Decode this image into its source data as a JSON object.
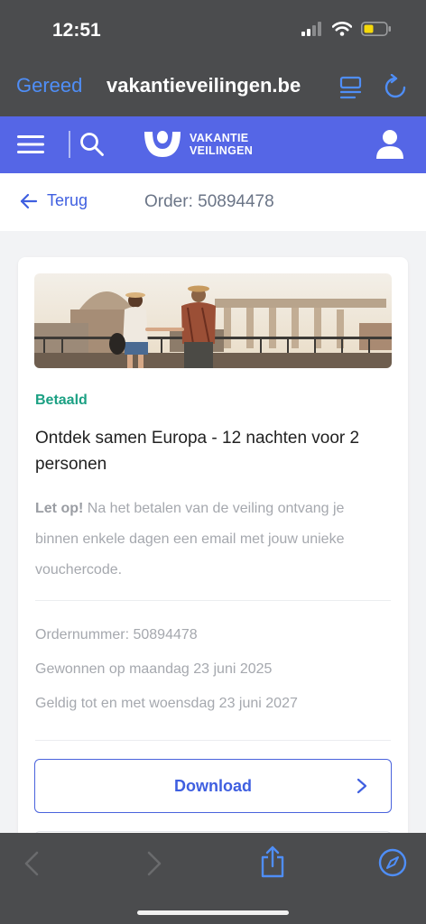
{
  "status_bar": {
    "time": "12:51"
  },
  "browser": {
    "done_label": "Gereed",
    "url": "vakantieveilingen.be"
  },
  "site": {
    "logo_line1": "VAKANTIE",
    "logo_line2": "VEILINGEN",
    "brand_color": "#5566e6"
  },
  "subnav": {
    "back_label": "Terug",
    "order_title": "Order: 50894478"
  },
  "order": {
    "status": "Betaald",
    "title": "Ontdek samen Europa - 12 nachten voor 2 personen",
    "notice_bold": "Let op!",
    "notice_text": " Na het betalen van de veiling ontvang je binnen enkele dagen een email met jouw unieke vouchercode.",
    "order_number": "Ordernummer: 50894478",
    "won_on": "Gewonnen op maandag 23 juni 2025",
    "valid_until": "Geldig tot en met woensdag 23 juni 2027",
    "download_label": "Download"
  },
  "icons": {
    "battery": "battery-low-icon",
    "wifi": "wifi-icon",
    "signal": "cellular-signal-icon",
    "menu": "hamburger-menu-icon",
    "search": "search-icon",
    "user": "user-icon",
    "back": "arrow-left-icon",
    "chevron": "chevron-right-icon",
    "share": "share-icon",
    "compass": "compass-icon"
  }
}
